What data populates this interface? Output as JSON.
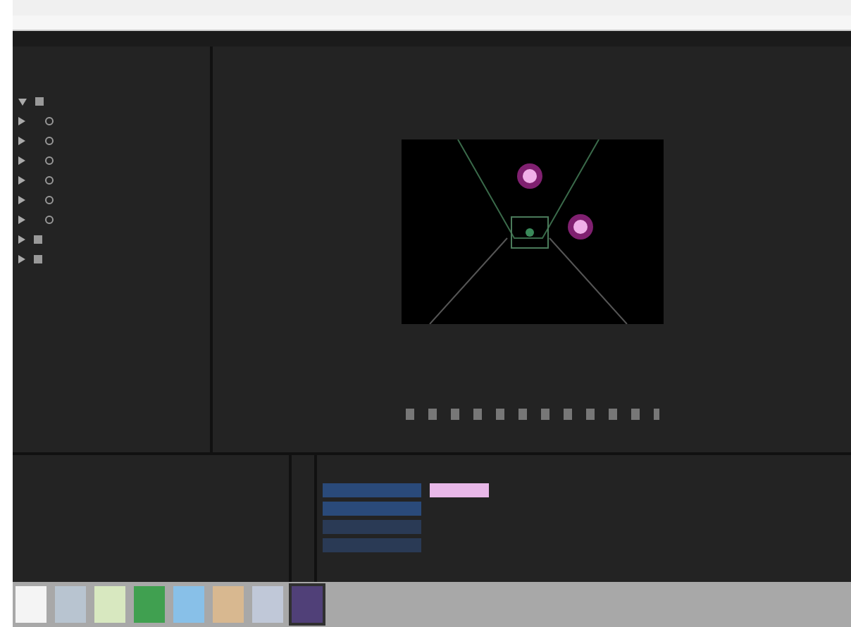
{
  "effect_rows": [
    {
      "kind": "group",
      "expanded": true
    },
    {
      "kind": "property",
      "expanded": false
    },
    {
      "kind": "property",
      "expanded": false
    },
    {
      "kind": "property",
      "expanded": false
    },
    {
      "kind": "property",
      "expanded": false
    },
    {
      "kind": "property",
      "expanded": false
    },
    {
      "kind": "property",
      "expanded": false
    },
    {
      "kind": "group",
      "expanded": false
    },
    {
      "kind": "group",
      "expanded": false
    }
  ],
  "timeline_tracks": [
    {
      "kind": "video",
      "color": "#e8b8e8"
    },
    {
      "kind": "video"
    },
    {
      "kind": "audio"
    },
    {
      "kind": "audio"
    }
  ],
  "taskbar_apps": [
    {
      "color": "#f4f4f4",
      "selected": false
    },
    {
      "color": "#b8c4d0",
      "selected": false
    },
    {
      "color": "#d8e8c0",
      "selected": false
    },
    {
      "color": "#40a050",
      "selected": false
    },
    {
      "color": "#88c0e8",
      "selected": false
    },
    {
      "color": "#d8b890",
      "selected": false
    },
    {
      "color": "#c0c8d8",
      "selected": false
    },
    {
      "color": "#504078",
      "selected": true
    }
  ]
}
